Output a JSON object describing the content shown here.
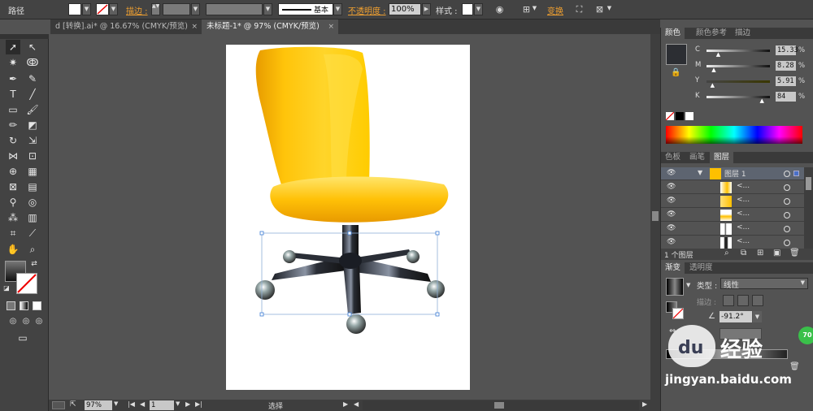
{
  "control_bar": {
    "object_type": "路径",
    "stroke_label": "描边 :",
    "stroke_style": "基本",
    "opacity_label": "不透明度 :",
    "opacity_value": "100%",
    "style_label": "样式 :",
    "transform_label": "变换"
  },
  "tabs": [
    {
      "label": "d [转换].ai* @ 16.67% (CMYK/预览)",
      "close": "×",
      "active": false
    },
    {
      "label": "未标题-1* @ 97% (CMYK/预览)",
      "close": "×",
      "active": true
    }
  ],
  "color_panel": {
    "tabs": [
      "颜色",
      "颜色参考",
      "描边"
    ],
    "sliders": [
      {
        "label": "C",
        "value": "15.33",
        "pct": 0.15
      },
      {
        "label": "M",
        "value": "8.28",
        "pct": 0.08
      },
      {
        "label": "Y",
        "value": "5.91",
        "pct": 0.06
      },
      {
        "label": "K",
        "value": "84",
        "pct": 0.84
      }
    ],
    "percent_sign": "%"
  },
  "layers_panel": {
    "tabs": [
      "色板",
      "画笔",
      "图层"
    ],
    "layer_name": "图层 1",
    "sublayer_label": "<...",
    "footer_count": "1 个图层"
  },
  "gradient_panel": {
    "tabs": [
      "渐变",
      "透明度"
    ],
    "type_label": "类型 :",
    "type_value": "线性",
    "stroke_label": "描边 :",
    "angle_value": "-91.2°"
  },
  "status_bar": {
    "zoom": "97%",
    "page": "1",
    "tool": "选择"
  },
  "watermark": {
    "logo_text": "du",
    "brand_text": "经验",
    "url_text": "jingyan.baidu.com",
    "badge": "70"
  },
  "colors": {
    "accent_orange": "#f0a030",
    "chair_yellow": "#ffc000",
    "selection_blue": "#3a7bd5"
  }
}
